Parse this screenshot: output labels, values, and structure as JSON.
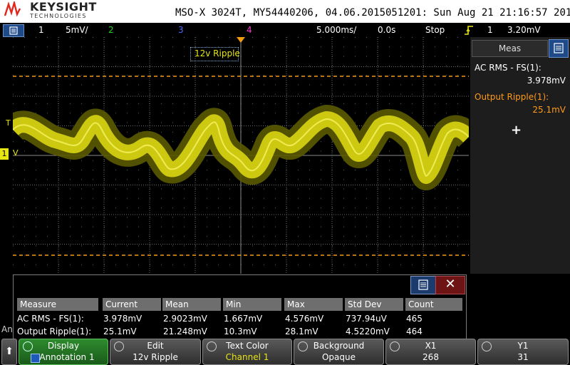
{
  "brand": {
    "name": "KEYSIGHT",
    "sub": "TECHNOLOGIES"
  },
  "title": "MSO-X 3024T, MY54440206, 04.06.2015051201: Sun Aug 21 21:16:57 2016",
  "status": {
    "ch1_num": "1",
    "ch1_scale": "5mV/",
    "ch2_num": "2",
    "ch3_num": "3",
    "ch4_num": "4",
    "timebase": "5.000ms/",
    "delay": "0.0s",
    "run_state": "Stop",
    "trig_source": "1",
    "trig_level": "3.20mV"
  },
  "colors": {
    "ch1": "#e7e512",
    "ch2": "#17d717",
    "ch3": "#4f6bff",
    "ch4": "#ff3ad0",
    "cursor": "#f39c12",
    "orange": "#ff9a1a"
  },
  "annotation": {
    "label": "12v Ripple"
  },
  "markers": {
    "trigger": "T",
    "ch1_ground": "1",
    "v": "V"
  },
  "meas_panel": {
    "header": "Meas",
    "m1_name": "AC RMS - FS(1):",
    "m1_value": "3.978mV",
    "m2_name": "Output Ripple(1):",
    "m2_value": "25.1mV",
    "add": "+"
  },
  "table": {
    "headers": [
      "Measure",
      "Current",
      "Mean",
      "Min",
      "Max",
      "Std Dev",
      "Count"
    ],
    "rows": [
      [
        "AC RMS - FS(1):",
        "3.978mV",
        "2.9023mV",
        "1.667mV",
        "4.576mV",
        "737.94uV",
        "465"
      ],
      [
        "Output Ripple(1):",
        "25.1mV",
        "21.248mV",
        "10.3mV",
        "28.1mV",
        "4.5220mV",
        "464"
      ]
    ],
    "close": "✕",
    "side_label": "An"
  },
  "softkeys": [
    {
      "label": "Display",
      "value": "Annotation 1"
    },
    {
      "label": "Edit",
      "value": "12v Ripple"
    },
    {
      "label": "Text Color",
      "value": "Channel 1"
    },
    {
      "label": "Background",
      "value": "Opaque"
    },
    {
      "label": "X1",
      "value": "268"
    },
    {
      "label": "Y1",
      "value": "31"
    }
  ],
  "back_arrow": "⬆"
}
